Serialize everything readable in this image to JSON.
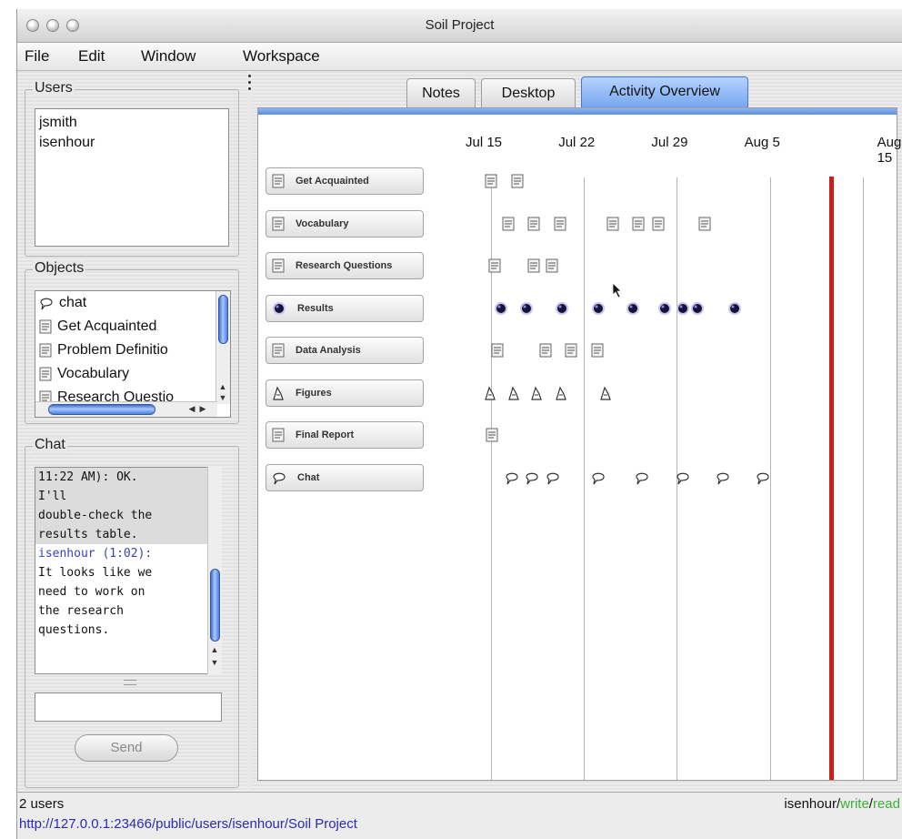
{
  "window": {
    "title": "Soil Project"
  },
  "menu": [
    "File",
    "Edit",
    "Window",
    "Workspace"
  ],
  "users": {
    "label": "Users",
    "items": [
      "jsmith",
      "isenhour"
    ]
  },
  "objects": {
    "label": "Objects",
    "items": [
      {
        "label": "chat",
        "icon": "chat-bubble-icon"
      },
      {
        "label": "Get Acquainted",
        "icon": "note-icon"
      },
      {
        "label": "Problem Definitio",
        "icon": "note-icon"
      },
      {
        "label": "Vocabulary",
        "icon": "note-icon"
      },
      {
        "label": "Research Questio",
        "icon": "note-icon"
      }
    ]
  },
  "chat": {
    "label": "Chat",
    "lines": [
      "11:22 AM): OK.",
      "I'll",
      "double-check the",
      "results table.",
      "isenhour (1:02):",
      "It looks like we",
      "need to work on",
      "the research",
      "questions."
    ],
    "input_value": "",
    "send_label": "Send"
  },
  "tabs": [
    "Notes",
    "Desktop",
    "Activity Overview"
  ],
  "active_tab": "Activity Overview",
  "chart_data": {
    "type": "scatter",
    "title": "",
    "x_tick_labels": [
      "Jul 15",
      "Jul 22",
      "Jul 29",
      "Aug 5",
      "Aug 15"
    ],
    "current_marker": "red vertical line (present day)",
    "categories": [
      "Get Acquainted",
      "Vocabulary",
      "Research Questions",
      "Results",
      "Data Analysis",
      "Figures",
      "Final Report",
      "Chat"
    ],
    "series": [
      {
        "category": "Get Acquainted",
        "icon": "note-icon",
        "x": [
          15,
          17
        ]
      },
      {
        "category": "Vocabulary",
        "icon": "note-icon",
        "x": [
          16.3,
          18.2,
          20.2,
          24.2,
          26.1,
          27.6,
          31.1
        ]
      },
      {
        "category": "Research Questions",
        "icon": "note-icon",
        "x": [
          15.3,
          18.2,
          19.6
        ]
      },
      {
        "category": "Results",
        "icon": "results-ball-icon",
        "x": [
          15.7,
          17.6,
          20.3,
          23,
          25.6,
          28,
          29.4,
          30.5,
          33.3
        ]
      },
      {
        "category": "Data Analysis",
        "icon": "note-icon",
        "x": [
          15.5,
          19.1,
          21,
          23
        ]
      },
      {
        "category": "Figures",
        "icon": "figure-icon",
        "x": [
          14.9,
          16.7,
          18.4,
          20.3,
          23.6
        ]
      },
      {
        "category": "Final Report",
        "icon": "note-icon",
        "x": [
          15.1
        ]
      },
      {
        "category": "Chat",
        "icon": "chat-bubble-icon",
        "x": [
          16.5,
          18,
          19.6,
          23,
          26.3,
          29.4,
          32.4,
          35.4
        ]
      }
    ]
  },
  "status": {
    "users_count": "2 users",
    "user": "isenhour",
    "sep1": "/",
    "write": "write",
    "sep2": "/",
    "read": "read",
    "url": "http://127.0.0.1:23466/public/users/isenhour/Soil Project",
    "write_color": "#3fae3a",
    "read_color": "#3fae3a"
  }
}
